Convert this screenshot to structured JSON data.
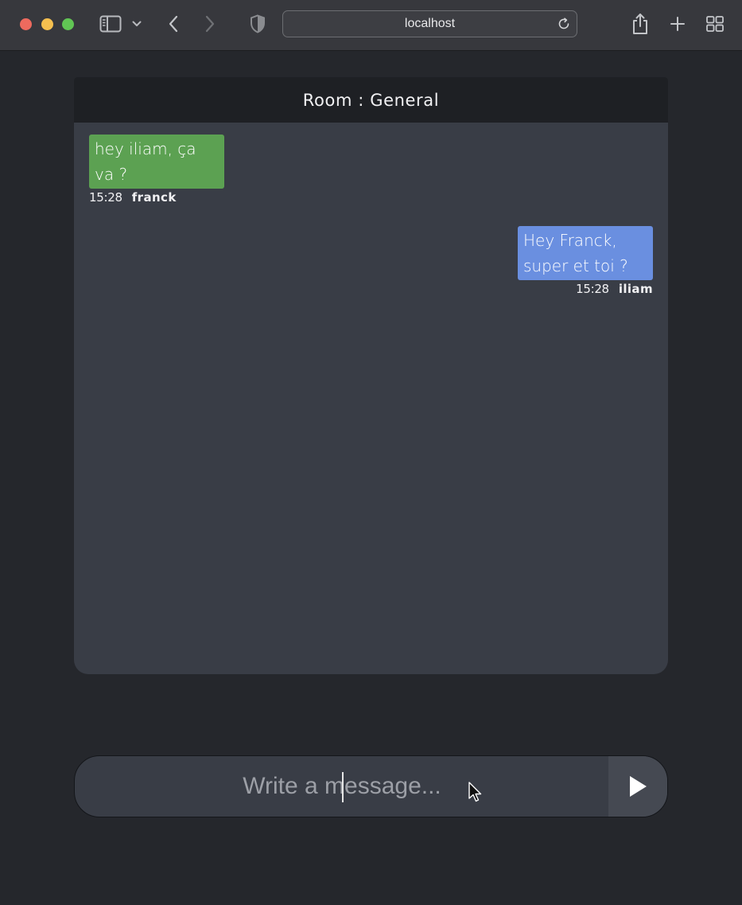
{
  "browser": {
    "url": "localhost",
    "icons": {
      "sidebar": "sidebar-icon",
      "sidebar_dropdown": "chevron-down-icon",
      "back": "chevron-left-icon",
      "forward": "chevron-right-icon",
      "privacy": "shield-icon",
      "reload": "reload-icon",
      "share": "share-icon",
      "new_tab": "plus-icon",
      "tab_overview": "grid-icon"
    }
  },
  "chat": {
    "room_title": "Room : General",
    "messages": [
      {
        "text": "hey iliam, ça va ?",
        "time": "15:28",
        "author": "franck",
        "side": "left",
        "color": "#5ca152"
      },
      {
        "text": "Hey Franck, super et toi ?",
        "time": "15:28",
        "author": "iliam",
        "side": "right",
        "color": "#6a8fe0"
      }
    ]
  },
  "composer": {
    "placeholder": "Write a message...",
    "send_icon": "play-icon"
  },
  "colors": {
    "background": "#25272c",
    "panel": "#393d46",
    "header": "#1e2024",
    "own_bubble": "#6a8fe0",
    "other_bubble": "#5ca152"
  }
}
